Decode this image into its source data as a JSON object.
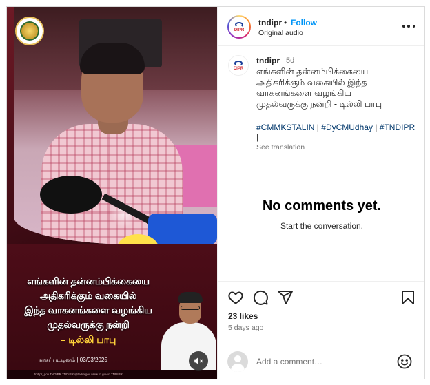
{
  "media": {
    "caption_lines": [
      "எங்களின் தன்னம்பிக்கையை",
      "அதிகரிக்கும் வகையில்",
      "இந்த வாகனங்களை வழங்கிய",
      "முதல்வருக்கு நன்றி"
    ],
    "caption_name": "– டில்லி பாபு",
    "place_date": "நாகப்பட்டினம் | 03/03/2025",
    "social_strip": "tndipr_gov   TNDIPR   TNDIPR   @tndiprgov   www.tn.gov.in   TNDIPR"
  },
  "header": {
    "username": "tndipr",
    "dot": "•",
    "follow_label": "Follow",
    "subtitle": "Original audio"
  },
  "post": {
    "username": "tndipr",
    "time": "5d",
    "text_lines": [
      "எங்களின் தன்னம்பிக்கையை",
      "அதிகரிக்கும் வகையில் இந்த",
      "வாகனங்களை வழங்கிய",
      "முதல்வருக்கு நன்றி - டில்லி பாபு"
    ],
    "tags": [
      "#CMMKSTALIN",
      "#DyCMUdhay",
      "#TNDIPR"
    ],
    "tag_separator": " | ",
    "trailing": "|",
    "see_translation": "See translation"
  },
  "comments": {
    "empty_title": "No comments yet.",
    "empty_subtitle": "Start the conversation."
  },
  "actions": {
    "likes": "23 likes",
    "ago": "5 days ago"
  },
  "comment_box": {
    "placeholder": "Add a comment…"
  },
  "colors": {
    "follow": "#0095f6",
    "hashtag": "#00376b",
    "media_maroon": "#4d0d18",
    "caption_yellow": "#ffd23a"
  },
  "icons": [
    "heart-icon",
    "comment-icon",
    "share-icon",
    "bookmark-icon",
    "mute-icon",
    "emoji-icon",
    "more-icon"
  ]
}
